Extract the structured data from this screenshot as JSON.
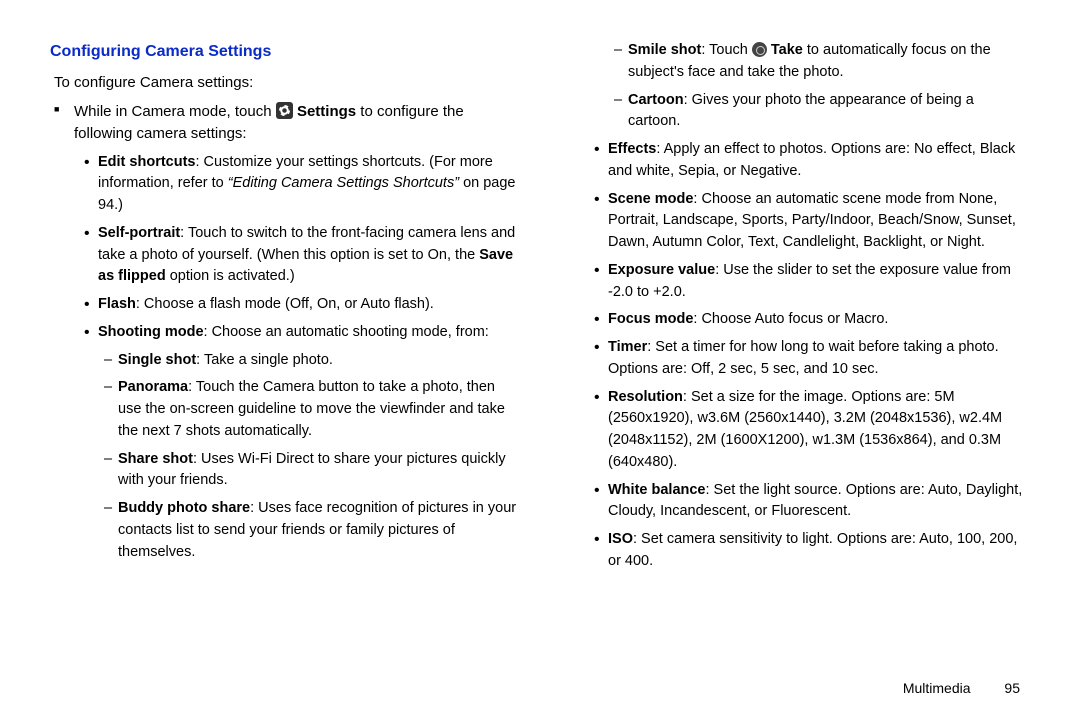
{
  "heading": "Configuring Camera Settings",
  "intro": "To configure Camera settings:",
  "main_item_pre": "While in Camera mode, touch ",
  "main_item_bold": "Settings",
  "main_item_post": " to configure the following camera settings:",
  "left": {
    "edit_b": "Edit shortcuts",
    "edit_t1": ": Customize your settings shortcuts. (For more information, refer to ",
    "edit_i": "“Editing Camera Settings Shortcuts”",
    "edit_t2": " on page 94.)",
    "self_b": "Self-portrait",
    "self_t1": ": Touch to switch to the front-facing camera lens and take a photo of yourself. (When this option is set to On, the ",
    "self_b2": "Save as flipped",
    "self_t2": " option is activated.)",
    "flash_b": "Flash",
    "flash_t": ": Choose a flash mode (Off, On, or Auto flash).",
    "shoot_b": "Shooting mode",
    "shoot_t": ": Choose an automatic shooting mode, from:",
    "single_b": "Single shot",
    "single_t": ": Take a single photo.",
    "pano_b": "Panorama",
    "pano_t": ": Touch the Camera button to take a photo, then use the on-screen guideline to move the viewfinder and take the next 7 shots automatically.",
    "share_b": "Share shot",
    "share_t": ": Uses Wi-Fi Direct to share your pictures quickly with your friends.",
    "buddy_b": "Buddy photo share",
    "buddy_t": ": Uses face recognition of pictures in your contacts list to send your friends or family pictures of themselves."
  },
  "right": {
    "smile_b": "Smile shot",
    "smile_t1": ": Touch ",
    "smile_b2": "Take",
    "smile_t2": " to automatically focus on the subject's face and take the photo.",
    "cartoon_b": "Cartoon",
    "cartoon_t": ": Gives your photo the appearance of being a cartoon.",
    "effects_b": "Effects",
    "effects_t": ": Apply an effect to photos. Options are: No effect, Black and white, Sepia, or Negative.",
    "scene_b": "Scene mode",
    "scene_t": ": Choose an automatic scene mode from None, Portrait, Landscape, Sports, Party/Indoor, Beach/Snow, Sunset, Dawn, Autumn Color, Text, Candlelight, Backlight, or Night.",
    "exp_b": "Exposure value",
    "exp_t": ": Use the slider to set the exposure value from -2.0 to +2.0.",
    "focus_b": "Focus mode",
    "focus_t": ": Choose Auto focus or Macro.",
    "timer_b": "Timer",
    "timer_t": ": Set a timer for how long to wait before taking a photo. Options are: Off, 2 sec, 5 sec, and 10 sec.",
    "res_b": "Resolution",
    "res_t": ": Set a size for the image. Options are: 5M (2560x1920), w3.6M (2560x1440), 3.2M (2048x1536), w2.4M (2048x1152), 2M (1600X1200), w1.3M (1536x864), and 0.3M (640x480).",
    "wb_b": "White balance",
    "wb_t": ": Set the light source. Options are: Auto, Daylight, Cloudy, Incandescent, or Fluorescent.",
    "iso_b": "ISO",
    "iso_t": ": Set camera sensitivity to light.  Options are: Auto, 100, 200, or 400."
  },
  "footer_section": "Multimedia",
  "footer_page": "95"
}
